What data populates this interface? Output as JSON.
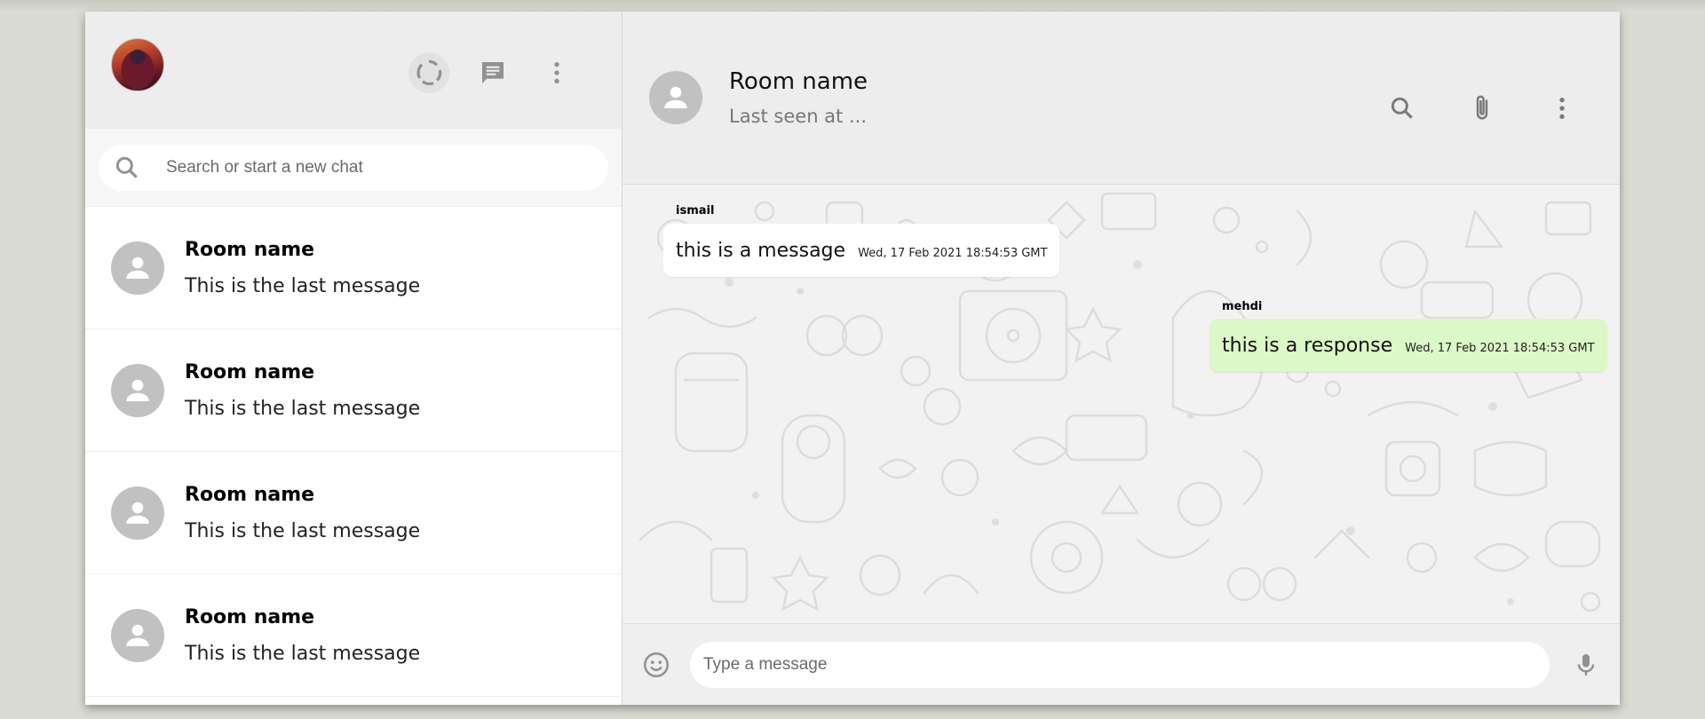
{
  "sidebar": {
    "search_placeholder": "Search or start a new chat",
    "icons": [
      "status-icon",
      "new-chat-icon",
      "more-vert-icon"
    ],
    "rooms": [
      {
        "name": "Room name",
        "last_message": "This is the last message"
      },
      {
        "name": "Room name",
        "last_message": "This is the last message"
      },
      {
        "name": "Room name",
        "last_message": "This is the last message"
      },
      {
        "name": "Room name",
        "last_message": "This is the last message"
      }
    ]
  },
  "chat": {
    "room_name": "Room name",
    "last_seen": "Last seen at ...",
    "header_icons": [
      "search-icon",
      "attach-icon",
      "more-vert-icon"
    ],
    "messages": [
      {
        "author": "ismail",
        "text": "this is a message",
        "time": "Wed, 17 Feb 2021 18:54:53 GMT",
        "mine": false
      },
      {
        "author": "mehdi",
        "text": "this is a response",
        "time": "Wed, 17 Feb 2021 18:54:53 GMT",
        "mine": true
      }
    ],
    "input_placeholder": "Type a message"
  },
  "colors": {
    "app_background": "#dadbd3",
    "header_background": "#ededed",
    "sent_bubble": "#dcf8c6",
    "received_bubble": "#ffffff",
    "icon_gray": "#919191"
  }
}
